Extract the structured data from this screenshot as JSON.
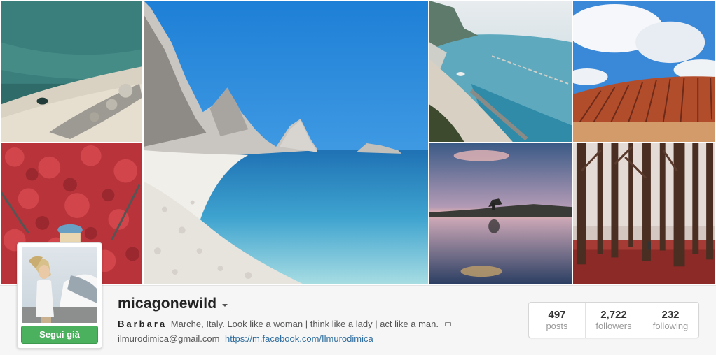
{
  "gallery": {
    "tiles": [
      {
        "name": "photo-sea-rocks-aerial"
      },
      {
        "name": "photo-red-leaves-swing"
      },
      {
        "name": "photo-white-beach-cliffs"
      },
      {
        "name": "photo-coastline-aerial"
      },
      {
        "name": "photo-vineyard-clouds"
      },
      {
        "name": "photo-lake-sunset"
      },
      {
        "name": "photo-autumn-forest"
      }
    ]
  },
  "profile": {
    "username": "micagonewild",
    "follow_button": "Segui già",
    "bio_name": "Barbara",
    "bio_text": "Marche, Italy. Look like a woman | think like a lady | act like a man.",
    "email": "ilmurodimica@gmail.com",
    "website": "https://m.facebook.com/Ilmurodimica"
  },
  "stats": [
    {
      "value": "497",
      "label": "posts"
    },
    {
      "value": "2,722",
      "label": "followers"
    },
    {
      "value": "232",
      "label": "following"
    }
  ],
  "colors": {
    "follow_green": "#4cb15e",
    "link_blue": "#2e6d9e"
  }
}
